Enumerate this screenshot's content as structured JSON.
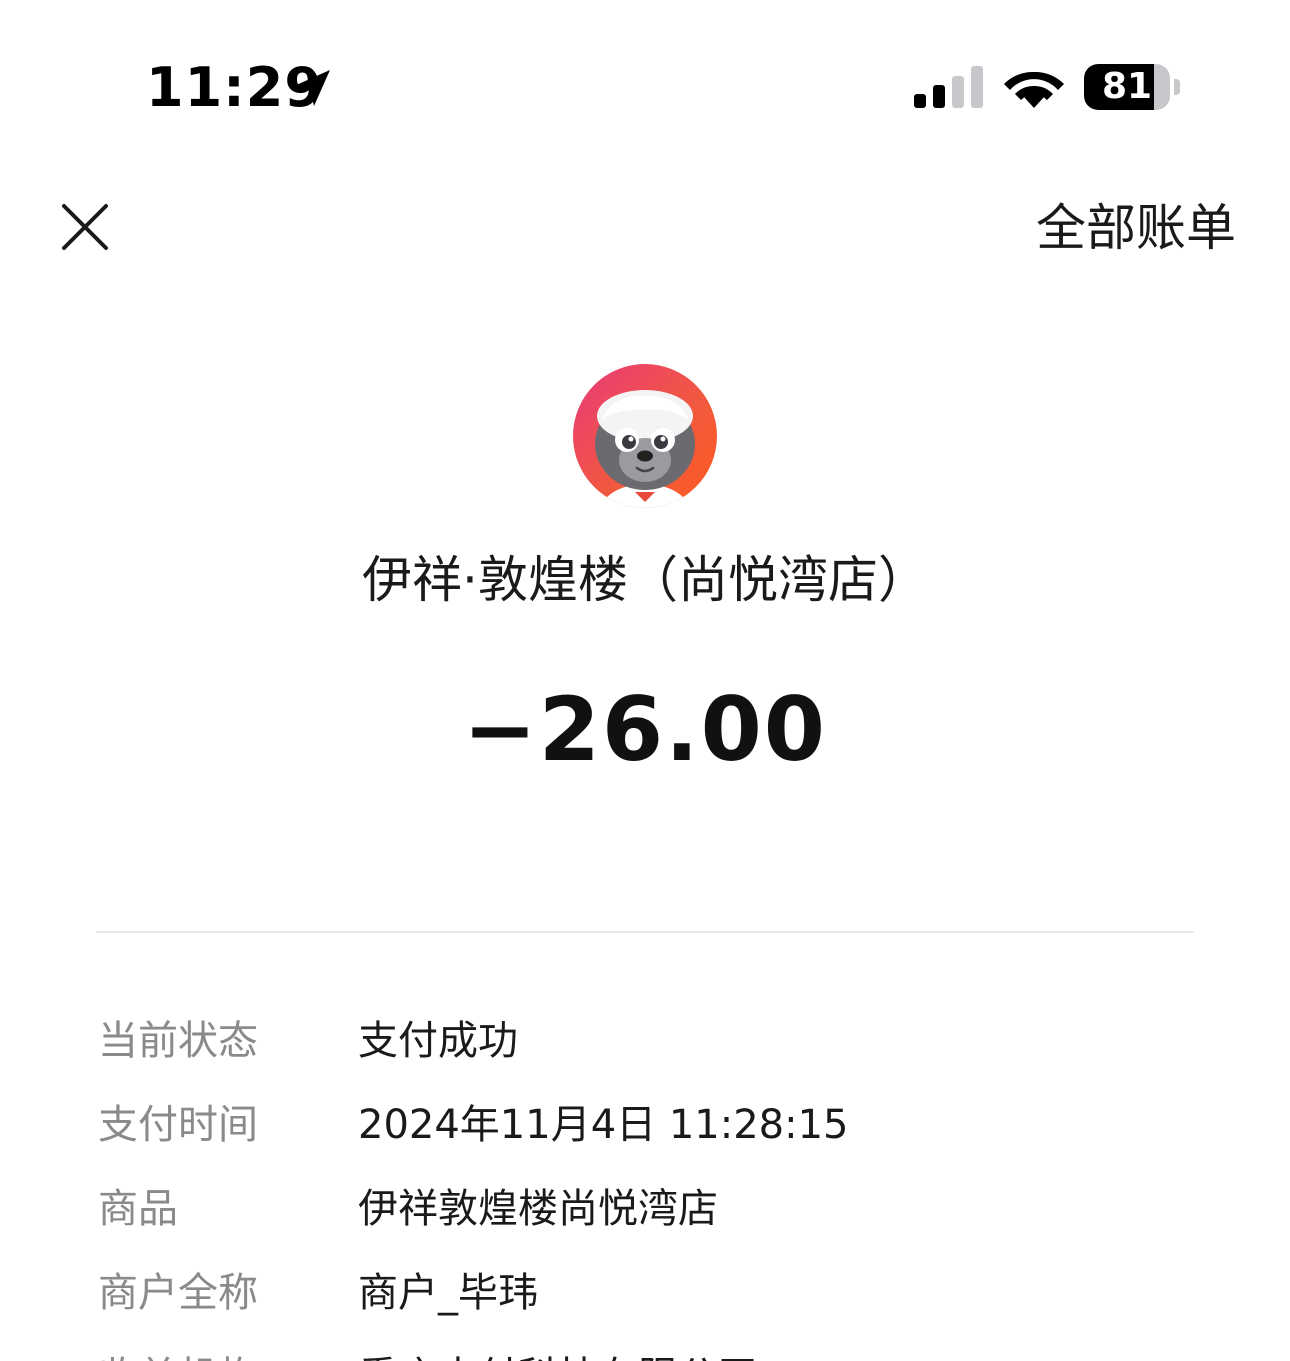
{
  "status_bar": {
    "time": "11:29",
    "battery_level": "81",
    "battery_fraction": 0.81
  },
  "nav": {
    "all_bills_label": "全部账单"
  },
  "merchant": {
    "name": "伊祥·敦煌楼（尚悦湾店）",
    "amount": "−26.00",
    "avatar_colors": [
      "#e83a7a",
      "#ff5a20"
    ]
  },
  "details": [
    {
      "label": "当前状态",
      "value": "支付成功"
    },
    {
      "label": "支付时间",
      "value": "2024年11月4日 11:28:15"
    },
    {
      "label": "商品",
      "value": "伊祥敦煌楼尚悦湾店"
    },
    {
      "label": "商户全称",
      "value": "商户_毕玮"
    },
    {
      "label": "收单机构",
      "value": "重庆支付科技有限公司"
    }
  ]
}
